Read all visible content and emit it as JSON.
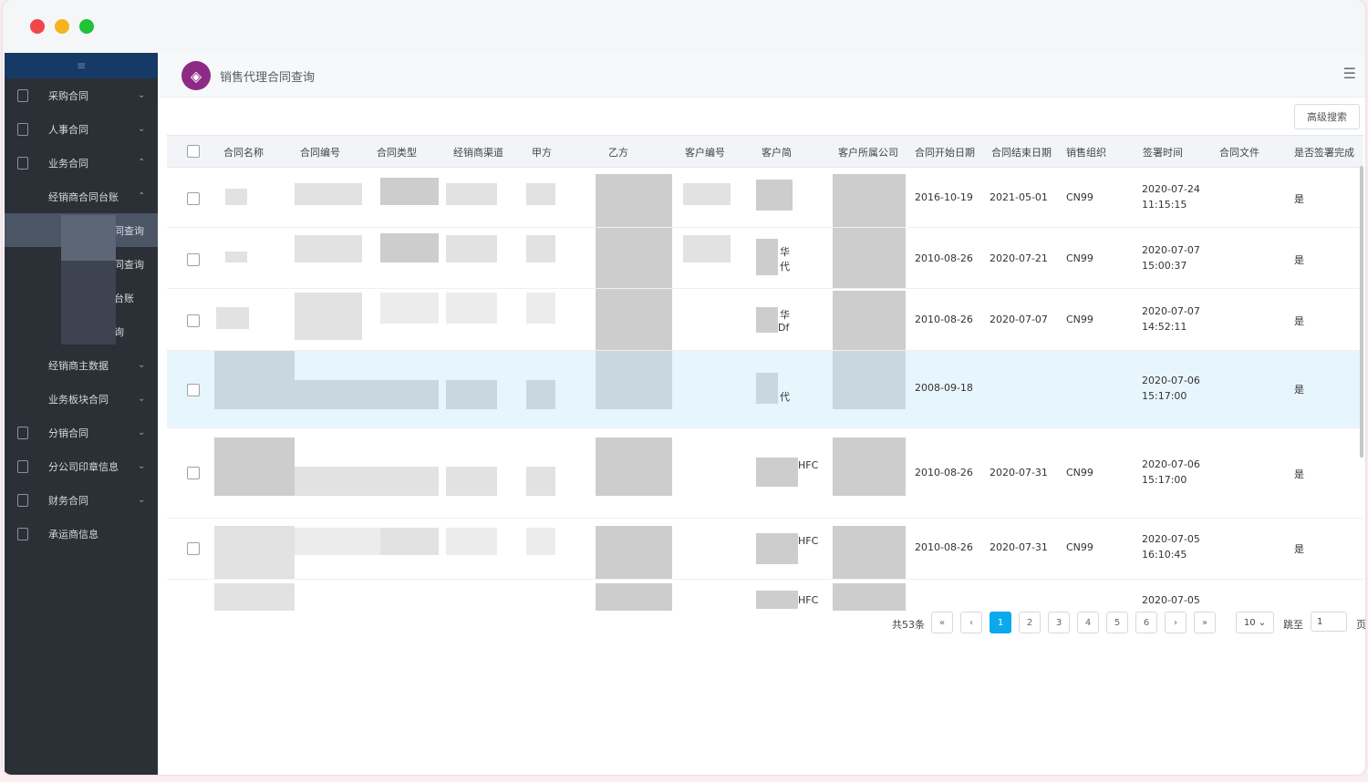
{
  "sidebar": {
    "items": [
      {
        "label": "采购合同"
      },
      {
        "label": "人事合同"
      },
      {
        "label": "业务合同"
      },
      {
        "label": "经销商合同台账"
      },
      {
        "label": "同查询"
      },
      {
        "label": "同查询"
      },
      {
        "label": "台账"
      },
      {
        "label": "询"
      },
      {
        "label": "经销商主数据"
      },
      {
        "label": "业务板块合同"
      },
      {
        "label": "分销合同"
      },
      {
        "label": "分公司印章信息"
      },
      {
        "label": "财务合同"
      },
      {
        "label": "承运商信息"
      }
    ]
  },
  "header": {
    "title": "销售代理合同查询"
  },
  "toolbar": {
    "advanced_search": "高级搜索"
  },
  "table": {
    "columns": [
      "合同名称",
      "合同编号",
      "合同类型",
      "经销商渠道",
      "甲方",
      "乙方",
      "客户编号",
      "客户简",
      "客户所属公司",
      "合同开始日期",
      "合同结束日期",
      "销售组织",
      "签署时间",
      "合同文件",
      "是否签署完成"
    ],
    "rows": [
      {
        "start": "2016-10-19",
        "end": "2021-05-01",
        "org": "CN99",
        "sign_date": "2020-07-24",
        "sign_time": "11:15:15",
        "done": "是"
      },
      {
        "start": "2010-08-26",
        "end": "2020-07-21",
        "org": "CN99",
        "sign_date": "2020-07-07",
        "sign_time": "15:00:37",
        "done": "是"
      },
      {
        "start": "2010-08-26",
        "end": "2020-07-07",
        "org": "CN99",
        "sign_date": "2020-07-07",
        "sign_time": "14:52:11",
        "done": "是"
      },
      {
        "start": "2008-09-18",
        "end": "",
        "org": "",
        "sign_date": "2020-07-06",
        "sign_time": "15:17:00",
        "done": "是"
      },
      {
        "start": "2010-08-26",
        "end": "2020-07-31",
        "org": "CN99",
        "sign_date": "2020-07-06",
        "sign_time": "15:17:00",
        "done": "是"
      },
      {
        "start": "2010-08-26",
        "end": "2020-07-31",
        "org": "CN99",
        "sign_date": "2020-07-05",
        "sign_time": "16:10:45",
        "done": "是"
      },
      {
        "start": "",
        "end": "",
        "org": "",
        "sign_date": "2020-07-05",
        "sign_time": "",
        "done": ""
      }
    ],
    "customer_fragments": [
      "华",
      "代",
      "华",
      "Df",
      "代",
      "HFC",
      "HFC",
      "HFC"
    ]
  },
  "pagination": {
    "total": "共53条",
    "pages": [
      "1",
      "2",
      "3",
      "4",
      "5",
      "6"
    ],
    "page_size": "10",
    "jump_label": "跳至",
    "jump_value": "1",
    "page_suffix": "页"
  }
}
